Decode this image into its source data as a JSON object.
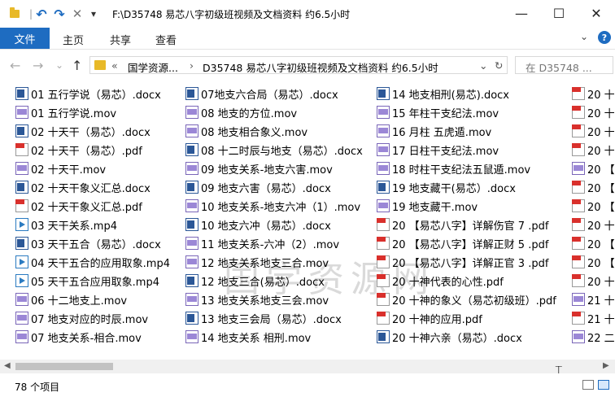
{
  "window": {
    "title": "F:\\D35748 易芯八字初级班视频及文档资料 约6.5小时",
    "minimize_icon": "—",
    "maximize_icon": "☐",
    "close_icon": "✕"
  },
  "quick_access": {
    "undo_icon": "↶",
    "redo_icon": "↷",
    "delete_icon": "✕",
    "dropdown_icon": "▾"
  },
  "ribbon": {
    "file_tab": "文件",
    "tabs": [
      "主页",
      "共享",
      "查看"
    ],
    "expand_icon": "⌄",
    "help_icon": "?"
  },
  "nav": {
    "back": "←",
    "forward": "→",
    "history": "⌄",
    "up": "↑",
    "breadcrumb_sep": "«",
    "path_parent": "国学资源...",
    "path_arrow": "›",
    "path_current": "D35748 易芯八字初级班视频及文档资料 约6.5小时",
    "dropdown": "⌄",
    "refresh": "↻",
    "search_placeholder": "在 D35748 ..."
  },
  "files": [
    {
      "name": "01 五行学说（易芯）.docx",
      "type": "docx"
    },
    {
      "name": "01 五行学说.mov",
      "type": "mov"
    },
    {
      "name": "02 十天干（易芯）.docx",
      "type": "docx"
    },
    {
      "name": "02 十天干（易芯）.pdf",
      "type": "pdf"
    },
    {
      "name": "02 十天干.mov",
      "type": "mov"
    },
    {
      "name": "02 十天干象义汇总.docx",
      "type": "docx"
    },
    {
      "name": "02 十天干象义汇总.pdf",
      "type": "pdf"
    },
    {
      "name": "03 天干关系.mp4",
      "type": "mp4"
    },
    {
      "name": "03 天干五合（易芯）.docx",
      "type": "docx"
    },
    {
      "name": "04 天干五合的应用取象.mp4",
      "type": "mp4"
    },
    {
      "name": "05 天干五合应用取象.mp4",
      "type": "mp4"
    },
    {
      "name": "06 十二地支上.mov",
      "type": "mov"
    },
    {
      "name": "07 地支对应的时辰.mov",
      "type": "mov"
    },
    {
      "name": "07 地支关系-相合.mov",
      "type": "mov"
    },
    {
      "name": "07地支六合局（易芯）.docx",
      "type": "docx"
    },
    {
      "name": "08 地支的方位.mov",
      "type": "mov"
    },
    {
      "name": "08 地支相合象义.mov",
      "type": "mov"
    },
    {
      "name": "08 十二时辰与地支（易芯）.docx",
      "type": "docx"
    },
    {
      "name": "09 地支关系-地支六害.mov",
      "type": "mov"
    },
    {
      "name": "09 地支六害（易芯）.docx",
      "type": "docx"
    },
    {
      "name": "10 地支关系-地支六冲（1）.mov",
      "type": "mov"
    },
    {
      "name": "10 地支六冲（易芯）.docx",
      "type": "docx"
    },
    {
      "name": "11 地支关系-六冲（2）.mov",
      "type": "mov"
    },
    {
      "name": "12 地支关系地支三合.mov",
      "type": "mov"
    },
    {
      "name": "12 地支三合(易芯）.docx",
      "type": "docx"
    },
    {
      "name": "13 地支关系地支三会.mov",
      "type": "mov"
    },
    {
      "name": "13 地支三会局（易芯）.docx",
      "type": "docx"
    },
    {
      "name": "14 地支关系 相刑.mov",
      "type": "mov"
    },
    {
      "name": "14 地支相刑(易芯).docx",
      "type": "docx"
    },
    {
      "name": "15 年柱干支纪法.mov",
      "type": "mov"
    },
    {
      "name": "16 月柱 五虎遁.mov",
      "type": "mov"
    },
    {
      "name": "17 日柱干支纪法.mov",
      "type": "mov"
    },
    {
      "name": "18 时柱干支纪法五鼠遁.mov",
      "type": "mov"
    },
    {
      "name": "19 地支藏干(易芯）.docx",
      "type": "docx"
    },
    {
      "name": "19 地支藏干.mov",
      "type": "mov"
    },
    {
      "name": "20 【易芯八字】详解伤官 7 .pdf",
      "type": "pdf"
    },
    {
      "name": "20 【易芯八字】详解正财 5 .pdf",
      "type": "pdf"
    },
    {
      "name": "20 【易芯八字】详解正官 3 .pdf",
      "type": "pdf"
    },
    {
      "name": "20 十神代表的心性.pdf",
      "type": "pdf"
    },
    {
      "name": "20 十神的象义（易芯初级班）.pdf",
      "type": "pdf"
    },
    {
      "name": "20 十神的应用.pdf",
      "type": "pdf"
    },
    {
      "name": "20 十神六亲（易芯）.docx",
      "type": "docx"
    },
    {
      "name": "20 十",
      "type": "pdf"
    },
    {
      "name": "20 十",
      "type": "pdf"
    },
    {
      "name": "20 十",
      "type": "pdf"
    },
    {
      "name": "20 十",
      "type": "pdf"
    },
    {
      "name": "20 【",
      "type": "mov"
    },
    {
      "name": "20 【",
      "type": "pdf"
    },
    {
      "name": "20 【",
      "type": "pdf"
    },
    {
      "name": "20 十",
      "type": "pdf"
    },
    {
      "name": "20 【",
      "type": "pdf"
    },
    {
      "name": "20 【",
      "type": "pdf"
    },
    {
      "name": "20 十",
      "type": "pdf"
    },
    {
      "name": "21 十",
      "type": "mov"
    },
    {
      "name": "21 十",
      "type": "pdf"
    },
    {
      "name": "22 二",
      "type": "mov"
    }
  ],
  "watermark": "国学资源网",
  "status": {
    "item_count": "78 个项目"
  }
}
